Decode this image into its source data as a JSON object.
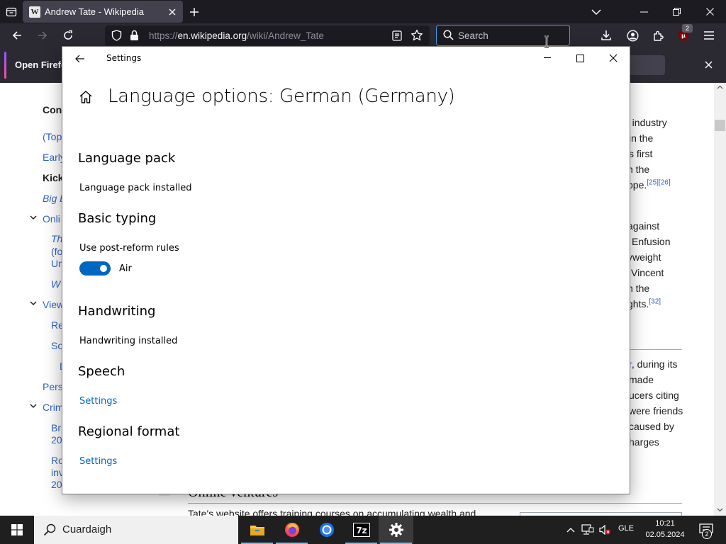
{
  "browser": {
    "tab_title": "Andrew Tate - Wikipedia",
    "tab_favicon": "W",
    "url_scheme": "https://",
    "url_host": "en.wikipedia.org",
    "url_path": "/wiki/Andrew_Tate",
    "search_placeholder": "Search",
    "extension_badge": "2"
  },
  "notification": {
    "text": "Open Firefo"
  },
  "toc": {
    "contents": "Con",
    "top": "(Top",
    "early": "Early",
    "kick": "Kick",
    "big": "Big E",
    "online": "Onli",
    "online_sub1": "Th",
    "online_sub2": "(fo",
    "online_sub3": "Un",
    "online_sub4": "W",
    "views": "View",
    "views_sub1": "Re",
    "views_sub2": "So",
    "views_sub3": "D",
    "pers": "Pers",
    "crim": "Crim",
    "crim_sub1": "Br",
    "crim_sub2": "20",
    "crim_sub3": "Ro",
    "crim_sub4": "inv",
    "crim_sub5": "20"
  },
  "article_fragments": {
    "p1": [
      "g industry",
      "in the",
      "s first",
      "n the",
      "ppe."
    ],
    "p1_cite": "[25][26]",
    "p2": [
      "against",
      "Enfusion",
      "yweight",
      "Vincent",
      "n the",
      "ghts."
    ],
    "p2_cite": "[32]",
    "p3_link": "r",
    "p3": [
      ", during its",
      "made",
      "ucers citing",
      "were friends",
      "caused by",
      "harges"
    ],
    "below_heading": "Online ventures",
    "below_text": "Tate's website offers training courses on accumulating wealth and"
  },
  "settings": {
    "window_title": "Settings",
    "heading": "Language options: German (Germany)",
    "sections": {
      "language_pack": {
        "title": "Language pack",
        "status": "Language pack installed"
      },
      "basic_typing": {
        "title": "Basic typing",
        "option": "Use post-reform rules",
        "toggle_state": "Air",
        "toggle_on": true
      },
      "handwriting": {
        "title": "Handwriting",
        "status": "Handwriting installed"
      },
      "speech": {
        "title": "Speech",
        "link": "Settings"
      },
      "regional_format": {
        "title": "Regional format",
        "link": "Settings"
      }
    },
    "accent_color": "#0067c0"
  },
  "taskbar": {
    "search_placeholder": "Cuardaigh",
    "apps": [
      "file-explorer",
      "firefox",
      "chromium",
      "7-zip",
      "settings"
    ],
    "language": "GLE",
    "time": "10:21",
    "date": "02.05.2024",
    "notification_count": "2"
  },
  "colors": {
    "firefox_tabbar": "#1c1b22",
    "firefox_toolbar": "#2b2a33",
    "wiki_link": "#3366cc",
    "taskbar": "#1f1f1f"
  }
}
